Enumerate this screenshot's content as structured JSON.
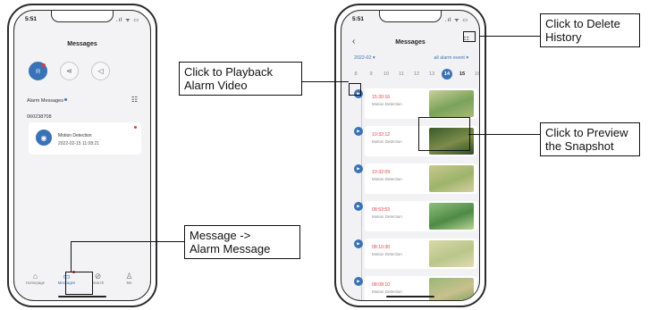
{
  "phone1": {
    "status_time": "5:51",
    "title": "Messages",
    "tabs": [
      {
        "icon": "bell-icon",
        "glyph": "♫",
        "active": true
      },
      {
        "icon": "share-icon",
        "glyph": "⋈",
        "active": false
      },
      {
        "icon": "speaker-icon",
        "glyph": "◁",
        "active": false
      }
    ],
    "section_label": "Alarm Messages",
    "device_id": "060238708",
    "alarm": {
      "type": "Motion Detection",
      "time": "2022-02-15  11:08:21"
    },
    "bottom_tabs": [
      {
        "label": "Homepage",
        "glyph": "⌂",
        "active": false
      },
      {
        "label": "Messages",
        "glyph": "▭",
        "active": true
      },
      {
        "label": "Search",
        "glyph": "⊘",
        "active": false
      },
      {
        "label": "Me",
        "glyph": "☺",
        "active": false
      }
    ]
  },
  "phone2": {
    "status_time": "5:51",
    "back_glyph": "‹",
    "title": "Messages",
    "month": "2022-02 ▾",
    "filter": "all alarm event ▾",
    "dates": [
      "8",
      "9",
      "10",
      "11",
      "12",
      "13",
      "14",
      "15",
      "16"
    ],
    "selected_date": "14",
    "events": [
      {
        "time": "15:30:16",
        "type": "Motion Detection",
        "thumb": [
          "#c9cf9a",
          "#7aa25a",
          "#a9b77a"
        ]
      },
      {
        "time": "10:32:12",
        "type": "Motion Detection",
        "thumb": [
          "#3b5a2a",
          "#7c8c4a",
          "#2f4d22"
        ]
      },
      {
        "time": "10:32:09",
        "type": "Motion Detection",
        "thumb": [
          "#c8c78f",
          "#9db46a",
          "#d6cfa2"
        ]
      },
      {
        "time": "08:53:53",
        "type": "Motion Detection",
        "thumb": [
          "#8fbf7a",
          "#4e8a47",
          "#b7d492"
        ]
      },
      {
        "time": "08:10:30",
        "type": "Motion Detection",
        "thumb": [
          "#d9d8a8",
          "#b9c68a",
          "#e2dbb2"
        ]
      },
      {
        "time": "08:08:10",
        "type": "Motion Detection",
        "thumb": [
          "#97b974",
          "#c9c08e",
          "#6f9f52"
        ]
      }
    ]
  },
  "callouts": {
    "delete": [
      "Click to Delete",
      "History"
    ],
    "playback": [
      "Click to Playback",
      "Alarm Video"
    ],
    "preview": [
      "Click to Preview",
      "the Snapshot"
    ],
    "message": [
      "Message ->",
      "Alarm Message"
    ]
  }
}
